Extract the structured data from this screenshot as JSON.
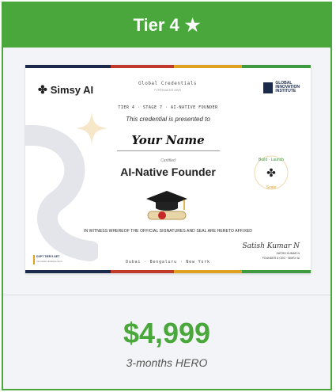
{
  "card": {
    "tier_label": "Tier 4",
    "tier_star": "★",
    "accent_color": "#4aa73c"
  },
  "certificate": {
    "brand": "Simsy AI",
    "brand_icon": "simsy-knot-icon",
    "global_credentials": "Global Credentials",
    "global_credentials_sub": "TYPEMAKER AWS",
    "institute_line1": "GLOBAL",
    "institute_line2": "INNOVATION",
    "institute_line3": "INSTITUTE",
    "tier_line": "TIER 4  ·  STAGE 7  ·  AI-NATIVE FOUNDER",
    "presented": "This credential is presented to",
    "recipient": "Your Name",
    "certified": "Certified",
    "title": "AI-Native Founder",
    "witness": "IN WITNESS WHEREOF THE OFFICIAL SIGNATURES AND SEAL ARE HERETO AFFIXED",
    "signature": "Satish Kumar N",
    "signer_name": "SATISH KUMAR N",
    "signer_role": "FOUNDER & CEO · SIMSY AI",
    "cities": "Dubai  ·  Bengaluru  ·  New York",
    "corner_line1": "DXPT TIER 5 GET",
    "corner_line2": "Innovation Endorsement",
    "seal_text": "Build · Launch · Scale"
  },
  "pricing": {
    "price": "$4,999",
    "plan": "3-months HERO"
  }
}
